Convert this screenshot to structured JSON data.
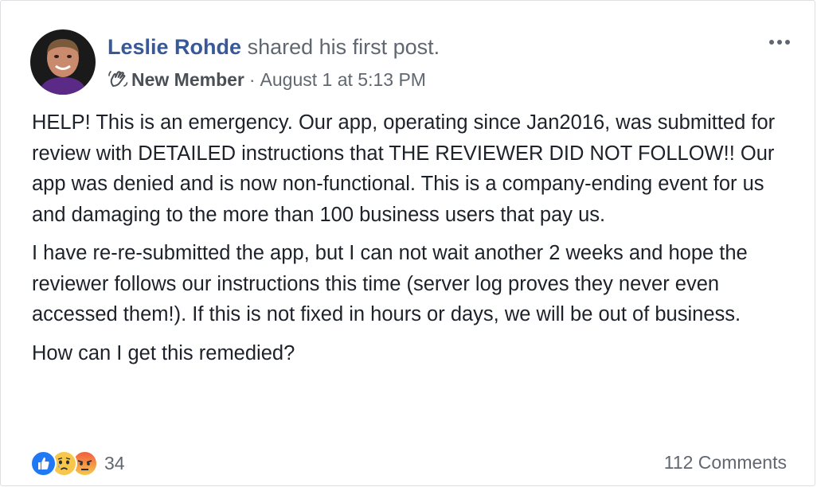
{
  "post": {
    "author_name": "Leslie Rohde",
    "action_text": "shared his first post.",
    "badge_icon": "wave-icon",
    "badge_label": "New Member",
    "separator": "·",
    "timestamp": "August 1 at 5:13 PM",
    "more_icon": "more-options-icon",
    "paragraphs": [
      "HELP! This is an emergency. Our app, operating since Jan2016, was submitted for review with DETAILED instructions that THE REVIEWER DID NOT FOLLOW!! Our app was denied and is now non-functional. This is a company-ending event for us and damaging to the more than 100 business users that pay us.",
      "I have re-re-submitted the app, but I can not wait another 2 weeks and hope the reviewer follows our instructions this time (server log proves they never even accessed them!). If this is not fixed in hours or days, we will be out of business.",
      "How can I get this remedied?"
    ]
  },
  "footer": {
    "reaction_icons": [
      "like-icon",
      "sad-icon",
      "angry-icon"
    ],
    "reaction_count": "34",
    "comments_label": "112 Comments"
  },
  "colors": {
    "author_link": "#385898",
    "secondary_text": "#606770",
    "body_text": "#1d2129",
    "like_blue": "#2078f4",
    "border": "#dddfe2"
  }
}
